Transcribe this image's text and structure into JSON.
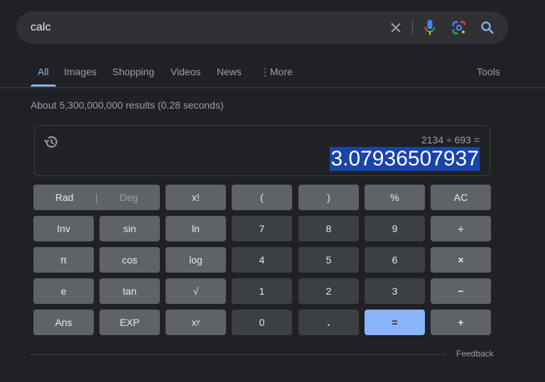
{
  "search": {
    "query": "calc"
  },
  "tabs": [
    {
      "label": "All"
    },
    {
      "label": "Images"
    },
    {
      "label": "Shopping"
    },
    {
      "label": "Videos"
    },
    {
      "label": "News"
    },
    {
      "label": "More"
    }
  ],
  "tools_label": "Tools",
  "result_stats": "About 5,300,000,000 results (0.28 seconds)",
  "calculator": {
    "expression": "2134 ÷ 693 =",
    "result": "3.07936507937",
    "keys": {
      "rad": "Rad",
      "deg": "Deg",
      "fact": "x!",
      "lparen": "(",
      "rparen": ")",
      "percent": "%",
      "ac": "AC",
      "inv": "Inv",
      "sin": "sin",
      "ln": "ln",
      "seven": "7",
      "eight": "8",
      "nine": "9",
      "divide": "÷",
      "pi": "π",
      "cos": "cos",
      "log": "log",
      "four": "4",
      "five": "5",
      "six": "6",
      "multiply": "×",
      "e": "e",
      "tan": "tan",
      "sqrt": "√",
      "one": "1",
      "two": "2",
      "three": "3",
      "minus": "−",
      "ans": "Ans",
      "exp": "EXP",
      "pow": "xʸ",
      "zero": "0",
      "dot": ".",
      "equals": "=",
      "plus": "+"
    }
  },
  "feedback_label": "Feedback",
  "colors": {
    "accent": "#8ab4f8",
    "background": "#202124",
    "highlight": "#1a44a8"
  }
}
